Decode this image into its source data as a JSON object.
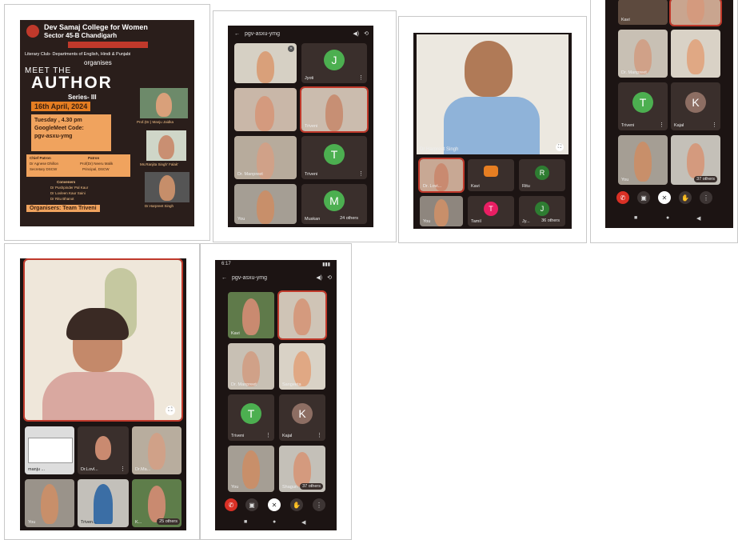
{
  "poster": {
    "college_line1": "Dev Samaj College for Women",
    "college_line2": "Sector 45-B Chandigarh",
    "club": "Literary Club- Departments of English, Hindi & Punjabi",
    "organises": "organises",
    "meet_the": "MEET THE",
    "author": "AUTHOR",
    "series": "Series- III",
    "date": "16th April, 2024",
    "time": "Tuesday , 4.30 pm",
    "meet_code_label": "GoogleMeet Code:",
    "meet_code": "pgv-asxu-ymg",
    "speaker1": "Prof.(Dr.) Manju Jaidka",
    "speaker2": "Ms.Ranjita Singh' Falak'",
    "speaker3": "Dr.Harpreet Singh",
    "chief_patron_title": "Chief Patron",
    "chief_patron_name": "Dr Agnese Dhillon",
    "chief_patron_role": "Secretary DSCW",
    "patron_title": "Patron",
    "patron_name": "Prof(Dr) Neeru Malik",
    "patron_role": "Principal, DSCW",
    "conveners_title": "Conveners",
    "convener1": "Dr Pushpinder Pal Kaur",
    "convener2": "Dr Lovleen Kaur Saini",
    "convener3": "Dr Ritu Bhanot",
    "organisers": "Organisers: Team Triveni"
  },
  "shot2": {
    "code": "pgv-asxu-ymg",
    "tiles": [
      "",
      "Jyoti",
      "",
      "Triveni",
      "Dr. Manpreet",
      "Triveni",
      "You",
      "Muskan",
      "24 others"
    ],
    "initials": [
      "J",
      "T",
      "M"
    ]
  },
  "shot3": {
    "speaker": "Dr Harpreet Singh",
    "tiles": [
      "Dr. Lovi...",
      "Kavi",
      "Ritu",
      "You",
      "Tamil",
      "Jy..."
    ],
    "initials": [
      "R",
      "T",
      "J"
    ],
    "others": "36 others"
  },
  "shot4": {
    "tiles": [
      "Kavi",
      "",
      "Dr. Manpreet",
      "",
      "Triveni",
      "Kajal",
      "You",
      "37 others"
    ],
    "initials": [
      "T",
      "K"
    ]
  },
  "shot5": {
    "tiles": [
      "manju ...",
      "Dr.Lovl...",
      "Dr.Ma...",
      "You",
      "Triven...",
      "K...",
      "25 others"
    ]
  },
  "shot6": {
    "status_time": "6:17",
    "code": "pgv-asxu-ymg",
    "tiles": [
      "Kavi",
      "",
      "Dr. Manpreet",
      "Sangeeta",
      "Triveni",
      "Kajal",
      "You",
      "Shagun",
      "37 others"
    ],
    "initials": [
      "T",
      "K"
    ]
  },
  "colors": {
    "accent": "#d93025",
    "tile": "#3a2f2c",
    "green": "#4caf50",
    "brown": "#8d6e63"
  }
}
